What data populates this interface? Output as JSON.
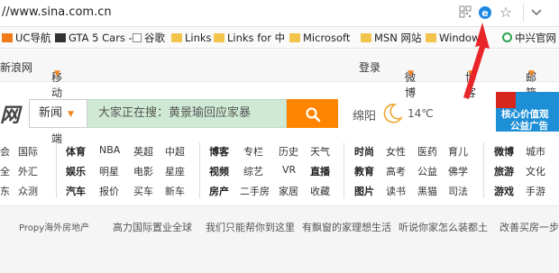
{
  "address_bar": {
    "url": "//www.sina.com.cn"
  },
  "bookmarks": [
    {
      "label": "UC导航",
      "icon": "uc-icon"
    },
    {
      "label": "GTA 5 Cars -",
      "icon": "page-icon"
    },
    {
      "label": "谷歌",
      "icon": "doc-icon"
    },
    {
      "label": "Links",
      "icon": "folder-icon"
    },
    {
      "label": "Links for 中",
      "icon": "folder-icon"
    },
    {
      "label": "Microsoft",
      "icon": "folder-icon"
    },
    {
      "label": "MSN 网站",
      "icon": "folder-icon"
    },
    {
      "label": "Windows",
      "icon": "folder-icon"
    },
    {
      "label": "中兴官网",
      "icon": "site-icon"
    }
  ],
  "nav": {
    "sina_news": "新浪网",
    "mobile_client": "移动客户端",
    "login": "登录",
    "weibo": "微博",
    "blog": "博客",
    "mail": "邮箱"
  },
  "logo_fragment": "网",
  "search": {
    "category": "新闻",
    "placeholder": "大家正在搜：黄景瑜回应家暴"
  },
  "weather": {
    "city": "绵阳",
    "temp": "14℃"
  },
  "ad": {
    "line1": "核心价值观",
    "line2": "公益广告"
  },
  "categories": {
    "col0": [
      "会",
      "全",
      "东"
    ],
    "col1": [
      "国际",
      "外汇",
      "众测"
    ],
    "col2": [
      [
        "体育",
        "NBA",
        "英超",
        "中超"
      ],
      [
        "娱乐",
        "明星",
        "电影",
        "星座"
      ],
      [
        "汽车",
        "报价",
        "买车",
        "新车"
      ]
    ],
    "col3": [
      [
        "博客",
        "专栏",
        "历史",
        "天气"
      ],
      [
        "视频",
        "综艺",
        "VR",
        "直播"
      ],
      [
        "房产",
        "二手房",
        "家居",
        "收藏"
      ]
    ],
    "col4": [
      [
        "时尚",
        "女性",
        "医药",
        "育儿"
      ],
      [
        "教育",
        "高考",
        "公益",
        "佛学"
      ],
      [
        "图片",
        "读书",
        "黑猫",
        "司法"
      ]
    ],
    "col5": [
      [
        "微博",
        "城市"
      ],
      [
        "旅游",
        "文化"
      ],
      [
        "游戏",
        "手游"
      ]
    ]
  },
  "footer_links": [
    "Propy海外房地产",
    "高力国际置业全球",
    "我们只能帮你到这里",
    "有飘窗的家理想生活",
    "听说你家怎么装都土",
    "改善买房一步到"
  ],
  "colors": {
    "accent": "#ff8400",
    "search_bg": "#cfe9d4",
    "arrow": "#e8262a"
  }
}
